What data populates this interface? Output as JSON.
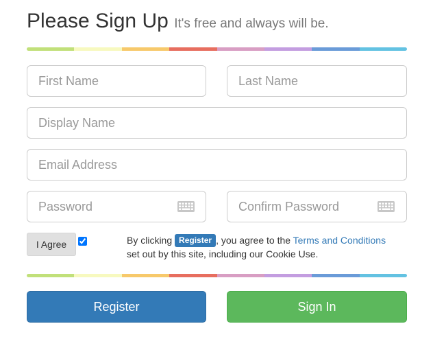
{
  "header": {
    "title": "Please Sign Up",
    "subtitle": "It's free and always will be."
  },
  "rainbow_colors": [
    "#c1e07a",
    "#f7f9bf",
    "#f7c96b",
    "#e76e5f",
    "#d89ec3",
    "#c39de0",
    "#6a9bd8",
    "#63c2e2"
  ],
  "form": {
    "first_name_placeholder": "First Name",
    "last_name_placeholder": "Last Name",
    "display_name_placeholder": "Display Name",
    "email_placeholder": "Email Address",
    "password_placeholder": "Password",
    "confirm_password_placeholder": "Confirm Password"
  },
  "icons": {
    "password_field": "keyboard-icon"
  },
  "agree": {
    "button_label": "I Agree",
    "checked": true
  },
  "terms": {
    "prefix": "By clicking",
    "badge_label": "Register",
    "middle": ", you agree to the",
    "link_text": "Terms and Conditions",
    "suffix": "set out by this site, including our Cookie Use."
  },
  "actions": {
    "register_label": "Register",
    "signin_label": "Sign In"
  },
  "colors": {
    "primary": "#337ab7",
    "success": "#5cb85c",
    "neutral": "#e0e0e0"
  }
}
